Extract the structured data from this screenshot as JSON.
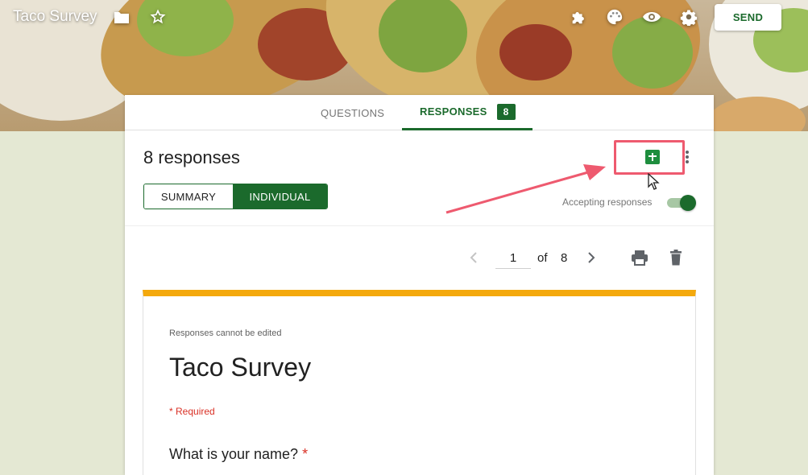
{
  "app": {
    "title": "Taco Survey",
    "send_label": "SEND"
  },
  "icons": {
    "folder": "folder-icon",
    "star": "star-icon",
    "addons": "puzzle-icon",
    "palette": "palette-icon",
    "preview": "eye-icon",
    "settings": "gear-icon",
    "sheets": "sheets-icon",
    "more": "more-vert-icon",
    "print": "print-icon",
    "delete": "trash-icon"
  },
  "tabs": {
    "questions": "QUESTIONS",
    "responses": "RESPONSES",
    "responses_badge": "8"
  },
  "responses": {
    "count_label": "8 responses",
    "summary_label": "SUMMARY",
    "individual_label": "INDIVIDUAL",
    "accepting_label": "Accepting responses",
    "accepting": true
  },
  "pager": {
    "current": "1",
    "of_label": "of",
    "total": "8"
  },
  "form": {
    "notice": "Responses cannot be edited",
    "title": "Taco Survey",
    "required_label": "* Required",
    "question_1": "What is your name?",
    "question_1_marker": "*"
  },
  "colors": {
    "brand_green": "#1b6a2c",
    "accent_orange": "#f4a90d",
    "annotation_pink": "#ee5a6f",
    "page_bg": "#e4e8d3"
  }
}
